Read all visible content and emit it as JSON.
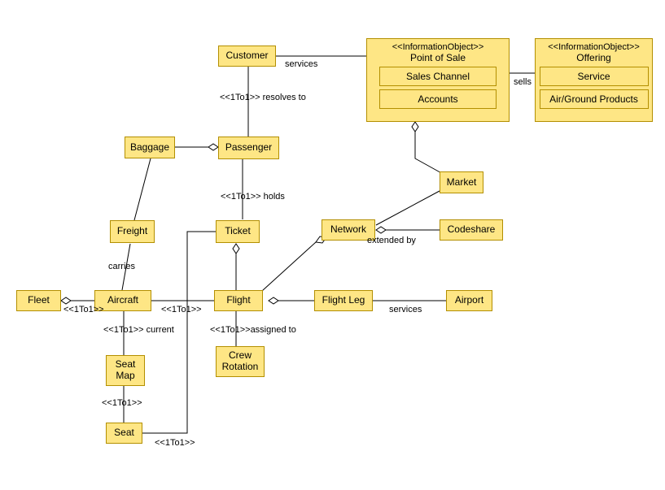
{
  "stereotypes": {
    "info_obj": "<<InformationObject>>",
    "one_to_one": "<<1To1>>"
  },
  "boxes": {
    "customer": "Customer",
    "baggage": "Baggage",
    "passenger": "Passenger",
    "freight": "Freight",
    "ticket": "Ticket",
    "fleet": "Fleet",
    "aircraft": "Aircraft",
    "flight": "Flight",
    "flight_leg": "Flight Leg",
    "airport": "Airport",
    "crew_rotation": "Crew\nRotation",
    "seat_map": "Seat\nMap",
    "seat": "Seat",
    "network": "Network",
    "codeshare": "Codeshare",
    "market": "Market"
  },
  "pos": {
    "title": "Point of Sale",
    "sales_channel": "Sales Channel",
    "accounts": "Accounts"
  },
  "offering": {
    "title": "Offering",
    "service": "Service",
    "products": "Air/Ground Products"
  },
  "edges": {
    "services1": "services",
    "sells": "sells",
    "resolves_to": "resolves to",
    "holds": "holds",
    "carries": "carries",
    "current": "current",
    "assigned_to": "assigned to",
    "extended_by": "extended by",
    "services2": "services"
  },
  "chart_data": {
    "type": "table",
    "diagram_kind": "UML class / object diagram with aggregation",
    "classes": [
      {
        "name": "Customer"
      },
      {
        "name": "Passenger"
      },
      {
        "name": "Baggage"
      },
      {
        "name": "Freight"
      },
      {
        "name": "Ticket"
      },
      {
        "name": "Flight"
      },
      {
        "name": "Flight Leg"
      },
      {
        "name": "Airport"
      },
      {
        "name": "Fleet"
      },
      {
        "name": "Aircraft"
      },
      {
        "name": "Seat Map"
      },
      {
        "name": "Seat"
      },
      {
        "name": "Crew Rotation"
      },
      {
        "name": "Network"
      },
      {
        "name": "Codeshare"
      },
      {
        "name": "Market"
      },
      {
        "name": "Point of Sale",
        "stereotype": "InformationObject",
        "parts": [
          "Sales Channel",
          "Accounts"
        ]
      },
      {
        "name": "Offering",
        "stereotype": "InformationObject",
        "parts": [
          "Service",
          "Air/Ground Products"
        ]
      }
    ],
    "associations": [
      {
        "from": "Customer",
        "to": "Point of Sale",
        "label": "services"
      },
      {
        "from": "Point of Sale",
        "to": "Offering",
        "label": "sells",
        "aggregation_at": "Offering"
      },
      {
        "from": "Sales Channel",
        "to": "Accounts",
        "aggregation_at": "Sales Channel"
      },
      {
        "from": "Service",
        "to": "Air/Ground Products",
        "aggregation_at": "Service"
      },
      {
        "from": "Customer",
        "to": "Passenger",
        "label": "resolves to",
        "stereotype": "1To1"
      },
      {
        "from": "Passenger",
        "to": "Baggage",
        "aggregation_at": "Passenger"
      },
      {
        "from": "Passenger",
        "to": "Ticket",
        "label": "holds",
        "stereotype": "1To1"
      },
      {
        "from": "Baggage",
        "to": "Freight"
      },
      {
        "from": "Freight",
        "to": "Aircraft",
        "label": "carries"
      },
      {
        "from": "Fleet",
        "to": "Aircraft",
        "stereotype": "1To1",
        "aggregation_at": "Fleet"
      },
      {
        "from": "Aircraft",
        "to": "Flight",
        "stereotype": "1To1"
      },
      {
        "from": "Aircraft",
        "to": "Seat Map",
        "label": "current",
        "stereotype": "1To1"
      },
      {
        "from": "Seat Map",
        "to": "Seat",
        "stereotype": "1To1"
      },
      {
        "from": "Seat",
        "to": "Ticket",
        "stereotype": "1To1"
      },
      {
        "from": "Ticket",
        "to": "Flight",
        "aggregation_at": "Ticket"
      },
      {
        "from": "Flight",
        "to": "Crew Rotation",
        "label": "assigned to",
        "stereotype": "1To1"
      },
      {
        "from": "Flight",
        "to": "Flight Leg",
        "aggregation_at": "Flight"
      },
      {
        "from": "Flight Leg",
        "to": "Airport",
        "label": "services"
      },
      {
        "from": "Network",
        "to": "Flight",
        "aggregation_at": "Network"
      },
      {
        "from": "Network",
        "to": "Codeshare",
        "label": "extended by",
        "aggregation_at": "Network"
      },
      {
        "from": "Point of Sale",
        "to": "Market",
        "aggregation_at": "Point of Sale"
      },
      {
        "from": "Network",
        "to": "Market"
      }
    ]
  }
}
